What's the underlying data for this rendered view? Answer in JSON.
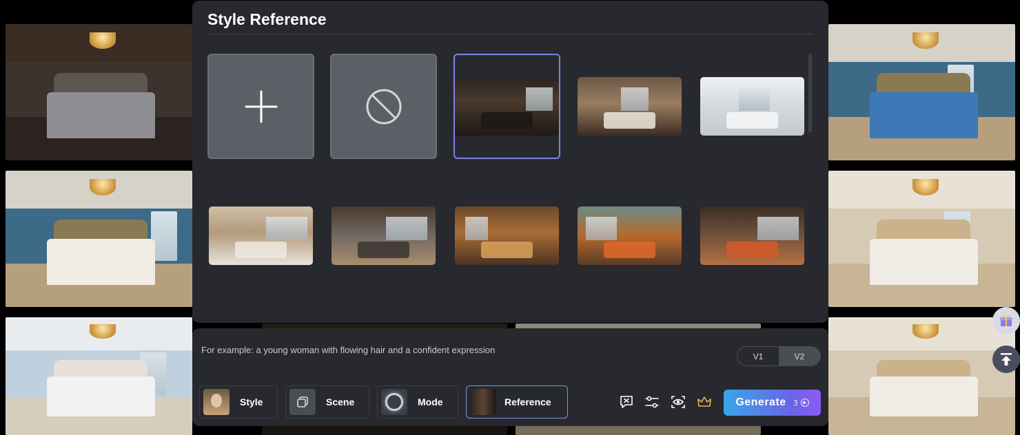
{
  "modal": {
    "title": "Style Reference",
    "add_tile": "add-reference",
    "none_tile": "no-reference"
  },
  "prompt": {
    "placeholder": "For example: a young woman with flowing hair and a confident expression"
  },
  "version": {
    "options": [
      "V1",
      "V2"
    ],
    "selected": "V2"
  },
  "chips": {
    "style": "Style",
    "scene": "Scene",
    "mode": "Mode",
    "reference": "Reference"
  },
  "generate": {
    "label": "Generate",
    "count": "3"
  },
  "icons": [
    "plus-icon",
    "no-entry-icon",
    "clear-prompt-icon",
    "settings-sliders-icon",
    "preview-eye-icon",
    "crown-icon",
    "gift-icon",
    "scroll-to-top-icon",
    "coin-icon"
  ],
  "colors": {
    "panel_bg": "#27292e",
    "selected_border": "#7c85e6",
    "generate_gradient_start": "#3aa6e8",
    "generate_gradient_end": "#8b5cf6"
  }
}
